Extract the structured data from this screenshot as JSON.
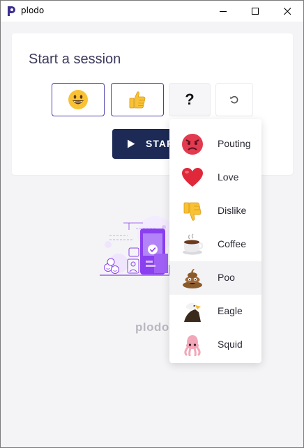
{
  "window": {
    "title": "plodo"
  },
  "session": {
    "heading": "Start a session",
    "question_label": "?",
    "start_label": "STAR"
  },
  "reactions": {
    "smiley_icon": "grinning-face",
    "thumb_icon": "thumbs-up",
    "reset_icon": "refresh"
  },
  "brand": {
    "name": "plodo."
  },
  "menu": {
    "items": [
      {
        "label": "Pouting",
        "icon": "pouting-face"
      },
      {
        "label": "Love",
        "icon": "red-heart"
      },
      {
        "label": "Dislike",
        "icon": "thumbs-down"
      },
      {
        "label": "Coffee",
        "icon": "hot-beverage"
      },
      {
        "label": "Poo",
        "icon": "pile-of-poo"
      },
      {
        "label": "Eagle",
        "icon": "eagle"
      },
      {
        "label": "Squid",
        "icon": "squid"
      }
    ]
  },
  "colors": {
    "accent": "#4a3fa8",
    "start_button": "#1c2a55",
    "heading": "#3d3a5c",
    "illustration": "#8a3ff0"
  }
}
